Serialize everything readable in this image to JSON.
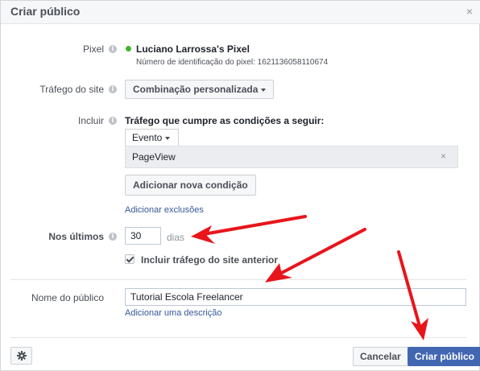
{
  "dialog": {
    "title": "Criar público",
    "close_icon": "×"
  },
  "pixel": {
    "label": "Pixel",
    "name": "Luciano Larrossa's Pixel",
    "id_text": "Número de identificação do pixel: 1621136058110674",
    "status_color": "#42b72a"
  },
  "traffic": {
    "label": "Tráfego do site",
    "value": "Combinação personalizada"
  },
  "include": {
    "label": "Incluir",
    "description": "Tráfego que cumpre as condições a seguir:",
    "event_label": "Evento",
    "event_value": "PageView",
    "remove_icon": "×",
    "add_condition": "Adicionar nova condição",
    "add_exclusions": "Adicionar exclusões"
  },
  "duration": {
    "label": "Nos últimos",
    "value": "30",
    "unit": "dias",
    "include_past_label": "Incluir tráfego do site anterior",
    "include_past_checked": true
  },
  "audience": {
    "label": "Nome do público",
    "value": "Tutorial Escola Freelancer",
    "add_description": "Adicionar uma descrição"
  },
  "footer": {
    "cancel": "Cancelar",
    "create": "Criar público"
  },
  "colors": {
    "primary": "#4267b2",
    "link": "#365899",
    "annotation_arrow": "#e8151b"
  }
}
